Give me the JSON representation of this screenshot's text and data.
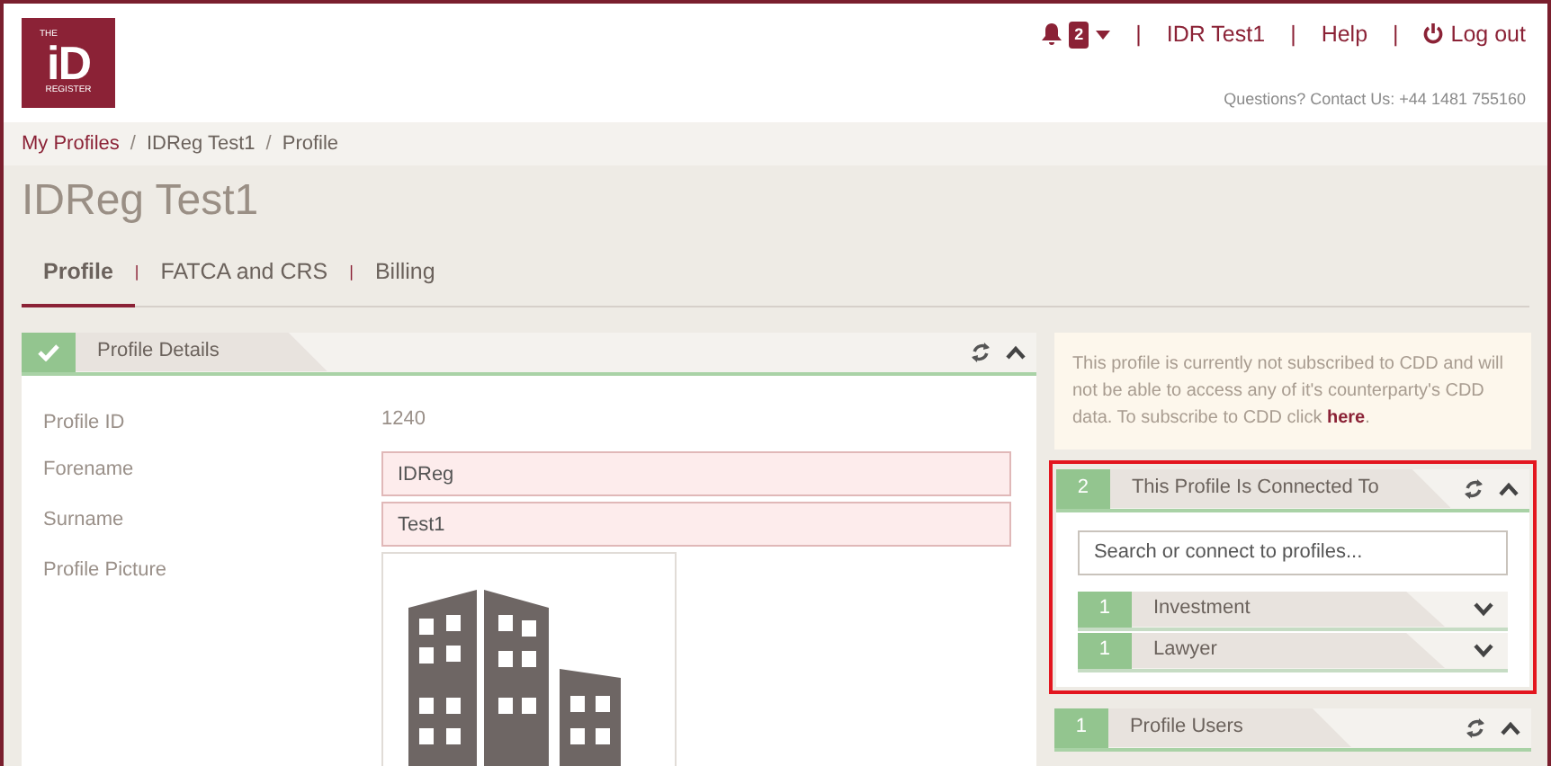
{
  "header": {
    "logo": {
      "small": "THE",
      "big": "iD",
      "caption": "REGISTER"
    },
    "notifications": {
      "count": "2"
    },
    "separators": [
      "|",
      "|",
      "|"
    ],
    "user": "IDR Test1",
    "help": "Help",
    "logout": "Log out",
    "contact": "Questions? Contact Us: +44 1481 755160"
  },
  "breadcrumb": [
    {
      "label": "My Profiles",
      "link": true
    },
    {
      "separator": "/",
      "label": "IDReg Test1",
      "link": false
    },
    {
      "separator": "/",
      "label": "Profile",
      "link": false
    }
  ],
  "title": "IDReg Test1",
  "tabs": [
    {
      "label": "Profile",
      "selected": true
    },
    {
      "separator": "|",
      "label": "FATCA and CRS",
      "selected": false
    },
    {
      "separator": "|",
      "label": "Billing",
      "selected": false
    }
  ],
  "details_panel": {
    "title": "Profile Details",
    "complete": true,
    "fields": [
      {
        "kind": "text",
        "label": "Profile ID",
        "value": "1240"
      },
      {
        "kind": "input",
        "label": "Forename",
        "value": "IDReg"
      },
      {
        "kind": "input",
        "label": "Surname",
        "value": "Test1"
      },
      {
        "kind": "picture",
        "label": "Profile Picture"
      }
    ]
  },
  "notice": {
    "text": "This profile is currently not subscribed to CDD and will not be able to access any of it's counterparty's CDD data. To subscribe to CDD click ",
    "link": "here",
    "end": "."
  },
  "connected_panel": {
    "count": "2",
    "title": "This Profile Is Connected To",
    "highlighted": true,
    "search": {
      "placeholder": "Search or connect to profiles..."
    },
    "groups": [
      {
        "count": "1",
        "label": "Investment",
        "expanded": false
      },
      {
        "count": "1",
        "label": "Lawyer",
        "expanded": false
      }
    ]
  },
  "users_panel": {
    "count": "1",
    "title": "Profile Users"
  }
}
